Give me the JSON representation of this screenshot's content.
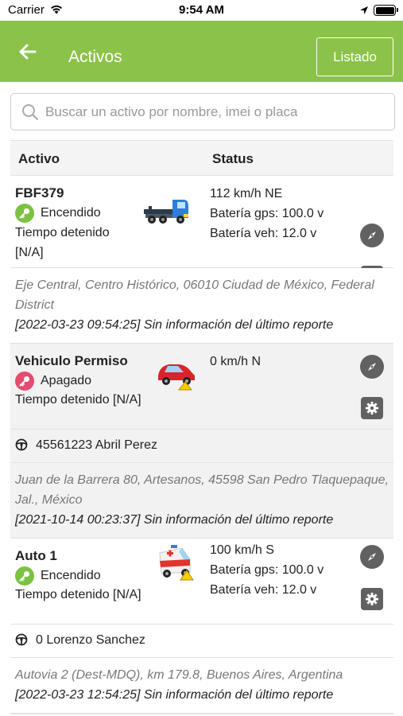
{
  "status_bar": {
    "carrier": "Carrier",
    "time": "9:54 AM"
  },
  "header": {
    "title": "Activos",
    "listado_label": "Listado",
    "bg_color": "#8bc34a"
  },
  "search": {
    "placeholder": "Buscar un activo por nombre, imei o placa"
  },
  "table": {
    "col_activo": "Activo",
    "col_status": "Status"
  },
  "assets": [
    {
      "name": "FBF379",
      "engine": "Encendido",
      "engine_on": true,
      "stopped_line1": "Tiempo detenido",
      "stopped_line2": "[N/A]",
      "speed": "112 km/h NE",
      "battery_gps": "Batería gps: 100.0 v",
      "battery_veh": "Batería veh: 12.0 v",
      "icon": "tow-truck-icon",
      "address": "Eje Central, Centro Histórico, 06010 Ciudad de México, Federal District",
      "report": "[2022-03-23 09:54:25] Sin información del último reporte"
    },
    {
      "name": "Vehiculo Permiso",
      "engine": "Apagado",
      "engine_on": false,
      "stopped": "Tiempo detenido [N/A]",
      "speed": "0 km/h N",
      "icon": "red-car-icon",
      "driver": "45561223 Abril Perez",
      "address": "Juan de la Barrera 80, Artesanos, 45598 San Pedro Tlaquepaque, Jal., México",
      "report": "[2021-10-14 00:23:37] Sin información del último reporte"
    },
    {
      "name": "Auto 1",
      "engine": "Encendido",
      "engine_on": true,
      "stopped": "Tiempo detenido [N/A]",
      "speed": "100 km/h S",
      "battery_gps": "Batería gps: 100.0 v",
      "battery_veh": "Batería veh: 12.0 v",
      "icon": "ambulance-icon",
      "driver": "0 Lorenzo Sanchez",
      "address": "Autovia 2 (Dest-MDQ), km 179.8, Buenos Aires, Argentina",
      "report": "[2022-03-23 12:54:25] Sin información del último reporte"
    }
  ]
}
